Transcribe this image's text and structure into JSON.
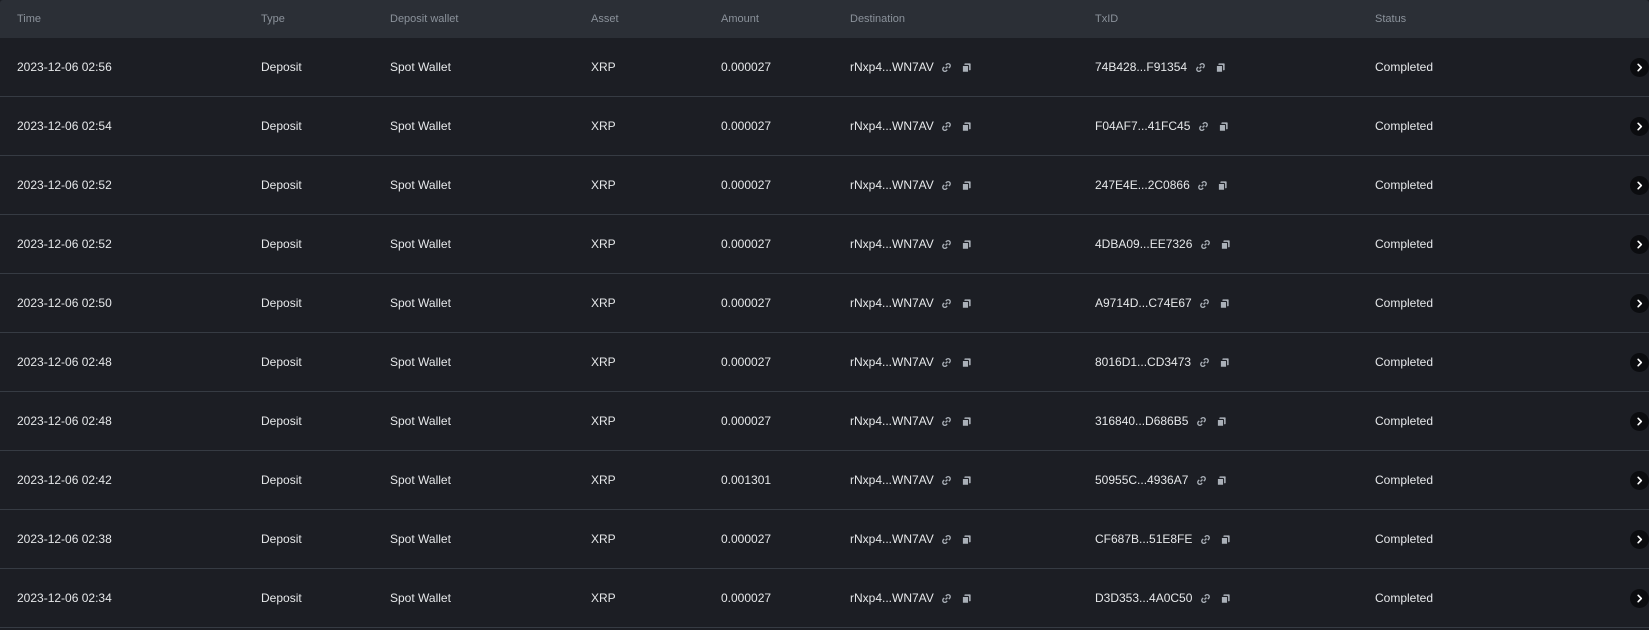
{
  "colors": {
    "background": "#1c1e24",
    "header_background": "#2b2f36",
    "header_text": "#8b929b",
    "row_text": "#e6e8ea",
    "divider": "#363b43",
    "icon": "#aab0b8",
    "action_button": "#0b0c0f"
  },
  "table": {
    "headers": {
      "time": "Time",
      "type": "Type",
      "wallet": "Deposit wallet",
      "asset": "Asset",
      "amount": "Amount",
      "destination": "Destination",
      "txid": "TxID",
      "status": "Status"
    },
    "rows": [
      {
        "time": "2023-12-06 02:56",
        "type": "Deposit",
        "wallet": "Spot Wallet",
        "asset": "XRP",
        "amount": "0.000027",
        "destination": "rNxp4...WN7AV",
        "txid": "74B428...F91354",
        "status": "Completed"
      },
      {
        "time": "2023-12-06 02:54",
        "type": "Deposit",
        "wallet": "Spot Wallet",
        "asset": "XRP",
        "amount": "0.000027",
        "destination": "rNxp4...WN7AV",
        "txid": "F04AF7...41FC45",
        "status": "Completed"
      },
      {
        "time": "2023-12-06 02:52",
        "type": "Deposit",
        "wallet": "Spot Wallet",
        "asset": "XRP",
        "amount": "0.000027",
        "destination": "rNxp4...WN7AV",
        "txid": "247E4E...2C0866",
        "status": "Completed"
      },
      {
        "time": "2023-12-06 02:52",
        "type": "Deposit",
        "wallet": "Spot Wallet",
        "asset": "XRP",
        "amount": "0.000027",
        "destination": "rNxp4...WN7AV",
        "txid": "4DBA09...EE7326",
        "status": "Completed"
      },
      {
        "time": "2023-12-06 02:50",
        "type": "Deposit",
        "wallet": "Spot Wallet",
        "asset": "XRP",
        "amount": "0.000027",
        "destination": "rNxp4...WN7AV",
        "txid": "A9714D...C74E67",
        "status": "Completed"
      },
      {
        "time": "2023-12-06 02:48",
        "type": "Deposit",
        "wallet": "Spot Wallet",
        "asset": "XRP",
        "amount": "0.000027",
        "destination": "rNxp4...WN7AV",
        "txid": "8016D1...CD3473",
        "status": "Completed"
      },
      {
        "time": "2023-12-06 02:48",
        "type": "Deposit",
        "wallet": "Spot Wallet",
        "asset": "XRP",
        "amount": "0.000027",
        "destination": "rNxp4...WN7AV",
        "txid": "316840...D686B5",
        "status": "Completed"
      },
      {
        "time": "2023-12-06 02:42",
        "type": "Deposit",
        "wallet": "Spot Wallet",
        "asset": "XRP",
        "amount": "0.001301",
        "destination": "rNxp4...WN7AV",
        "txid": "50955C...4936A7",
        "status": "Completed"
      },
      {
        "time": "2023-12-06 02:38",
        "type": "Deposit",
        "wallet": "Spot Wallet",
        "asset": "XRP",
        "amount": "0.000027",
        "destination": "rNxp4...WN7AV",
        "txid": "CF687B...51E8FE",
        "status": "Completed"
      },
      {
        "time": "2023-12-06 02:34",
        "type": "Deposit",
        "wallet": "Spot Wallet",
        "asset": "XRP",
        "amount": "0.000027",
        "destination": "rNxp4...WN7AV",
        "txid": "D3D353...4A0C50",
        "status": "Completed"
      }
    ],
    "row_icons": {
      "link": "link-icon",
      "copy": "copy-icon",
      "details": "chevron-right-icon"
    }
  }
}
